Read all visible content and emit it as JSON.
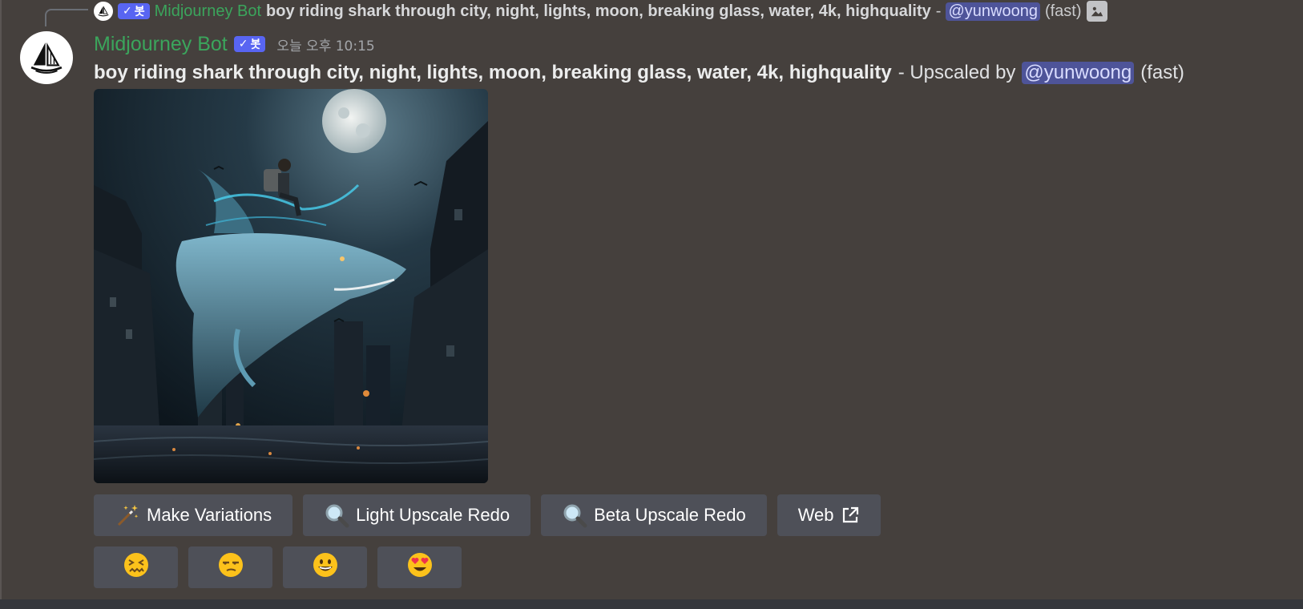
{
  "reply": {
    "author": "Midjourney Bot",
    "bot_tag": "봇",
    "prompt": "boy riding shark through city, night, lights, moon, breaking glass, water, 4k, highquality",
    "dash": "-",
    "mention": "@yunwoong",
    "speed": "(fast)"
  },
  "message": {
    "author": "Midjourney Bot",
    "bot_tag": "봇",
    "timestamp": "오늘 오후 10:15",
    "prompt": "boy riding shark through city, night, lights, moon, breaking glass, water, 4k, highquality",
    "upscaled_text": "- Upscaled by",
    "mention": "@yunwoong",
    "speed": "(fast)"
  },
  "buttons": [
    {
      "label": "Make Variations",
      "icon": "magic-wand-icon"
    },
    {
      "label": "Light Upscale Redo",
      "icon": "magnifier-icon"
    },
    {
      "label": "Beta Upscale Redo",
      "icon": "magnifier-icon"
    },
    {
      "label": "Web",
      "icon": "external-link-icon"
    }
  ],
  "reactions": [
    {
      "emoji": "😖",
      "icon": "confounded-face-icon"
    },
    {
      "emoji": "😒",
      "icon": "unamused-face-icon"
    },
    {
      "emoji": "😀",
      "icon": "grinning-face-icon"
    },
    {
      "emoji": "😍",
      "icon": "heart-eyes-face-icon"
    }
  ],
  "colors": {
    "background": "#45403d",
    "author": "#3ba55c",
    "badge": "#5865f2",
    "mention_bg": "#4e5499",
    "button": "#4e5058"
  }
}
